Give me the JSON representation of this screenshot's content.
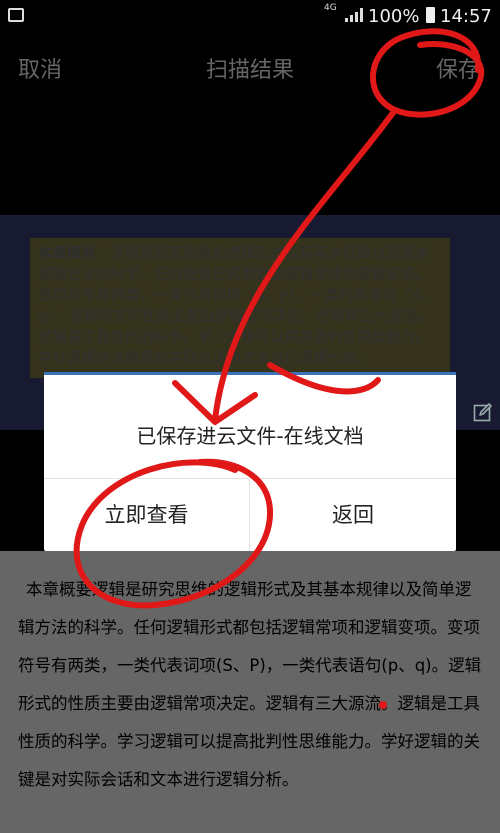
{
  "status_bar": {
    "network": "4G",
    "battery_percent": "100%",
    "time": "14:57",
    "icons": [
      "gallery-icon",
      "signal-icon",
      "battery-icon"
    ]
  },
  "top_bar": {
    "cancel_label": "取消",
    "title": "扫描结果",
    "save_label": "保存"
  },
  "scan_preview": {
    "heading": "本章概要",
    "separator": "：",
    "body": "逻辑是研究思维的逻辑形式及其基本规律以及简单逻辑方法的科学。任何逻辑形式都包括逻辑常项和逻辑变项。变项符号有两类，一类代表词项（S、P），一类代表语句（p、q）。逻辑形式的性质主要由逻辑常项决定。逻辑有三大源流。逻辑是工具性质的科学。学习逻辑可以提高批判性思维能力。学好逻辑的关键是对实际会话和文本进行逻辑分析。"
  },
  "dialog": {
    "message": "已保存进云文件-在线文档",
    "view_now_label": "立即查看",
    "back_label": "返回",
    "accent_color": "#3b73b9"
  },
  "result_text": {
    "body": "本章概要逻辑是研究思维的逻辑形式及其基本规律以及简单逻辑方法的科学。任何逻辑形式都包括逻辑常项和逻辑变项。变项符号有两类，一类代表词项(S、P)，一类代表语句(p、q)。逻辑形式的性质主要由逻辑常项决定。逻辑有三大源流。逻辑是工具性质的科学。学习逻辑可以提高批判性思维能力。学好逻辑的关键是对实际会话和文本进行逻辑分析。"
  },
  "annotation_color": "#e01818"
}
